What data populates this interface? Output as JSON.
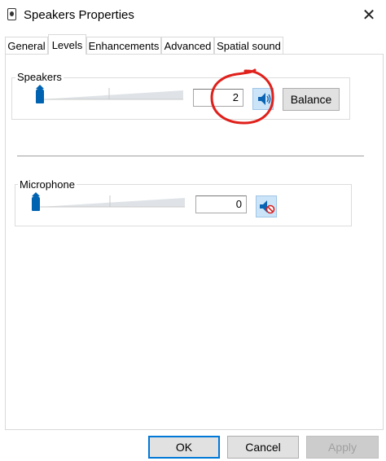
{
  "window": {
    "title": "Speakers Properties",
    "close_glyph": "✕",
    "title_icon": "speaker-device-icon"
  },
  "tabs": [
    {
      "label": "General",
      "active": false
    },
    {
      "label": "Levels",
      "active": true
    },
    {
      "label": "Enhancements",
      "active": false
    },
    {
      "label": "Advanced",
      "active": false
    },
    {
      "label": "Spatial sound",
      "active": false
    }
  ],
  "levels": {
    "speakers": {
      "label": "Speakers",
      "value": "2",
      "level_fraction": 0.02,
      "muted": false,
      "mute_icon": "speaker-volume-icon",
      "balance_label": "Balance"
    },
    "microphone": {
      "label": "Microphone",
      "value": "0",
      "level_fraction": 0.0,
      "muted": true,
      "mute_icon": "speaker-muted-icon"
    }
  },
  "footer": {
    "ok_label": "OK",
    "cancel_label": "Cancel",
    "apply_label": "Apply"
  },
  "colors": {
    "accent": "#0078d7",
    "slider_thumb": "#0063b1",
    "annotation": "#e0201b"
  }
}
